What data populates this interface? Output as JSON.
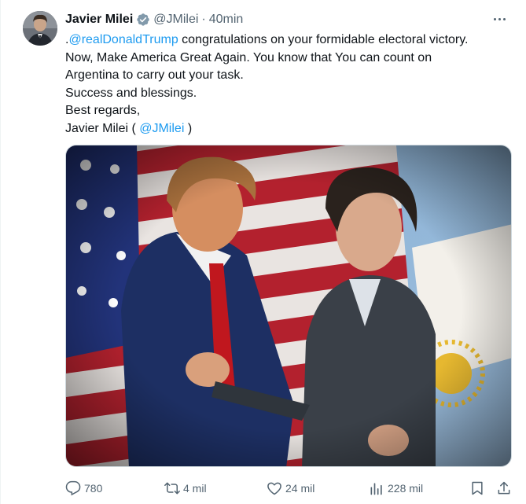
{
  "author": {
    "name": "Javier Milei",
    "handle": "@JMilei",
    "separator": "·",
    "time": "40min"
  },
  "tweet": {
    "lines": [
      {
        "prefix": ".",
        "mention": "@realDonaldTrump",
        "rest": " congratulations on your formidable electoral victory."
      },
      {
        "text": "Now, Make America Great Again. You know that You can count on"
      },
      {
        "text": "Argentina to carry out your task."
      },
      {
        "text": "Success and blessings."
      },
      {
        "text": "Best regards,"
      },
      {
        "prefix": "Javier Milei ( ",
        "mention": "@JMilei",
        "rest": " )"
      }
    ]
  },
  "actions": {
    "replies": "780",
    "reposts": "4 mil",
    "likes": "24 mil",
    "views": "228 mil"
  },
  "colors": {
    "accent": "#1d9bf0",
    "text": "#0f1419",
    "muted": "#536471",
    "verified": "#829aab"
  },
  "icons": [
    "verified-badge-icon",
    "more-icon",
    "reply-icon",
    "repost-icon",
    "like-icon",
    "views-icon",
    "bookmark-icon",
    "share-icon"
  ]
}
